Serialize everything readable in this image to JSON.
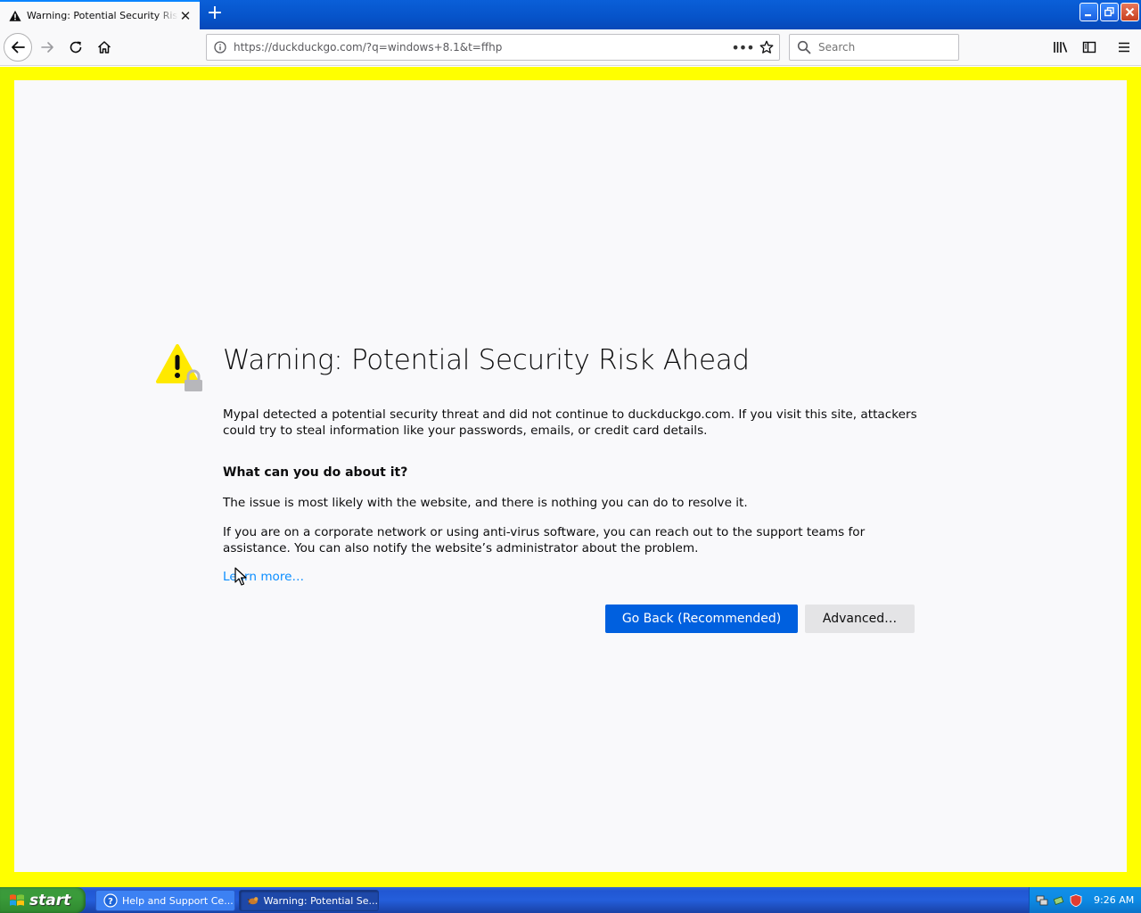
{
  "browser": {
    "tab_title": "Warning: Potential Security Risk Ahead",
    "url": "https://duckduckgo.com/?q=windows+8.1&t=ffhp",
    "search_placeholder": "Search"
  },
  "page": {
    "title": "Warning: Potential Security Risk Ahead",
    "description": "Mypal detected a potential security threat and did not continue to duckduckgo.com. If you visit this site, attackers could try to steal information like your passwords, emails, or credit card details.",
    "what_heading": "What can you do about it?",
    "issue_text": "The issue is most likely with the website, and there is nothing you can do to resolve it.",
    "corporate_text": "If you are on a corporate network or using anti-virus software, you can reach out to the support teams for assistance. You can also notify the website’s administrator about the problem.",
    "learn_more": "Learn more…",
    "go_back_label": "Go Back (Recommended)",
    "advanced_label": "Advanced…"
  },
  "taskbar": {
    "start_label": "start",
    "tasks": [
      {
        "label": "Help and Support Ce...",
        "icon": "help-icon",
        "active": false
      },
      {
        "label": "Warning: Potential Se...",
        "icon": "mypal-icon",
        "active": true
      }
    ],
    "clock": "9:26 AM"
  },
  "colors": {
    "page_border": "#ffff00",
    "primary_button": "#0060df",
    "link": "#0a8dff",
    "warning": "#ffe900",
    "titlebar": "#0653c9",
    "start_button": "#3a9b3a"
  }
}
